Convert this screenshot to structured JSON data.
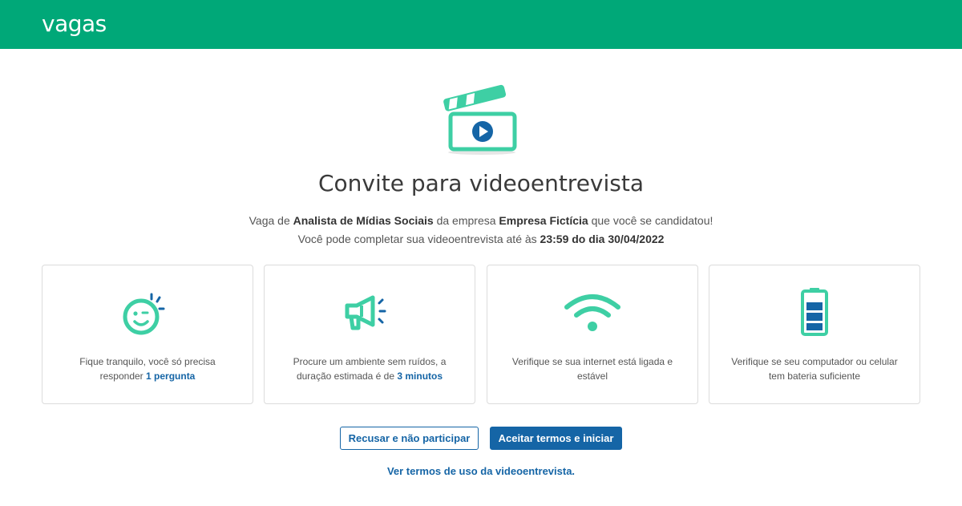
{
  "header": {
    "logo": "vagas",
    "brand_color": "#00a878"
  },
  "hero": {
    "icon": "clapperboard-play-icon",
    "title": "Convite para videoentrevista",
    "line1": {
      "p1": "Vaga de ",
      "job": "Analista de Mídias Sociais",
      "p2": " da empresa ",
      "company": "Empresa Fictícia",
      "p3": " que você se candidatou!"
    },
    "line2": {
      "p1": "Você pode completar sua videoentrevista até às ",
      "deadline": "23:59 do dia 30/04/2022"
    }
  },
  "cards": [
    {
      "icon": "smiley-wink-icon",
      "text_before": "Fique tranquilo, você só precisa responder ",
      "highlight": "1 pergunta",
      "text_after": ""
    },
    {
      "icon": "megaphone-icon",
      "text_before": "Procure um ambiente sem ruídos, a duração estimada é de ",
      "highlight": "3 minutos",
      "text_after": ""
    },
    {
      "icon": "wifi-icon",
      "text_before": "Verifique se sua internet está ligada e estável",
      "highlight": "",
      "text_after": ""
    },
    {
      "icon": "battery-icon",
      "text_before": "Verifique se seu computador ou celular tem bateria suficiente",
      "highlight": "",
      "text_after": ""
    }
  ],
  "actions": {
    "decline": "Recusar e não participar",
    "accept": "Aceitar termos e iniciar",
    "terms_link": "Ver termos de uso da videoentrevista."
  },
  "colors": {
    "accent_green": "#3ecfa4",
    "primary_blue": "#1565a6"
  }
}
